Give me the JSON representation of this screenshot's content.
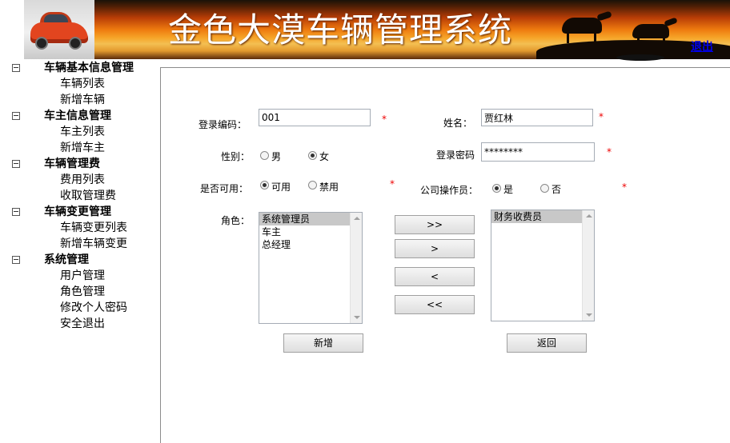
{
  "header": {
    "title": "金色大漠车辆管理系统",
    "logout": "退出"
  },
  "sidebar": {
    "groups": [
      {
        "label": "车辆基本信息管理",
        "items": [
          "车辆列表",
          "新增车辆"
        ]
      },
      {
        "label": "车主信息管理",
        "items": [
          "车主列表",
          "新增车主"
        ]
      },
      {
        "label": "车辆管理费",
        "items": [
          "费用列表",
          "收取管理费"
        ]
      },
      {
        "label": "车辆变更管理",
        "items": [
          "车辆变更列表",
          "新增车辆变更"
        ]
      },
      {
        "label": "系统管理",
        "items": [
          "用户管理",
          "角色管理",
          "修改个人密码",
          "安全退出"
        ]
      }
    ]
  },
  "form": {
    "login_code": {
      "label": "登录编码：",
      "value": "001"
    },
    "name": {
      "label": "姓名：",
      "value": "贾红林"
    },
    "gender": {
      "label": "性别：",
      "options": [
        "男",
        "女"
      ],
      "selected": "女"
    },
    "password": {
      "label": "登录密码",
      "value": "********"
    },
    "enabled": {
      "label": "是否可用：",
      "options": [
        "可用",
        "禁用"
      ],
      "selected": "可用"
    },
    "operator": {
      "label": "公司操作员：",
      "options": [
        "是",
        "否"
      ],
      "selected": "是"
    },
    "required_mark": "*",
    "roles": {
      "label": "角色：",
      "available": [
        "系统管理员",
        "车主",
        "总经理"
      ],
      "available_selected": "系统管理员",
      "assigned": [
        "财务收费员"
      ],
      "assigned_selected": "财务收费员"
    },
    "buttons": {
      "move_all_right": ">>",
      "move_right": ">",
      "move_left": "<",
      "move_all_left": "<<",
      "add": "新增",
      "back": "返回"
    }
  }
}
